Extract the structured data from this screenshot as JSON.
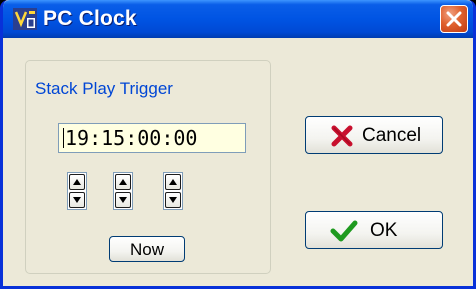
{
  "window": {
    "title": "PC Clock",
    "icons": {
      "app": "pc-clock-app-icon",
      "close": "close-x-icon"
    },
    "colors": {
      "titlebar": "#0054e3",
      "client": "#ece9d8",
      "group_label": "#0046d5",
      "field_bg": "#ffffe1"
    }
  },
  "trigger_group": {
    "label": "Stack Play Trigger",
    "time_value": "19:15:00:00",
    "spinners": [
      {
        "name": "hours-spinner",
        "up_icon": "arrow-up-icon",
        "down_icon": "arrow-down-icon"
      },
      {
        "name": "minutes-spinner",
        "up_icon": "arrow-up-icon",
        "down_icon": "arrow-down-icon"
      },
      {
        "name": "seconds-spinner",
        "up_icon": "arrow-up-icon",
        "down_icon": "arrow-down-icon"
      }
    ],
    "now_label": "Now"
  },
  "actions": {
    "cancel_label": "Cancel",
    "cancel_icon": "red-x-icon",
    "ok_label": "OK",
    "ok_icon": "green-check-icon"
  }
}
